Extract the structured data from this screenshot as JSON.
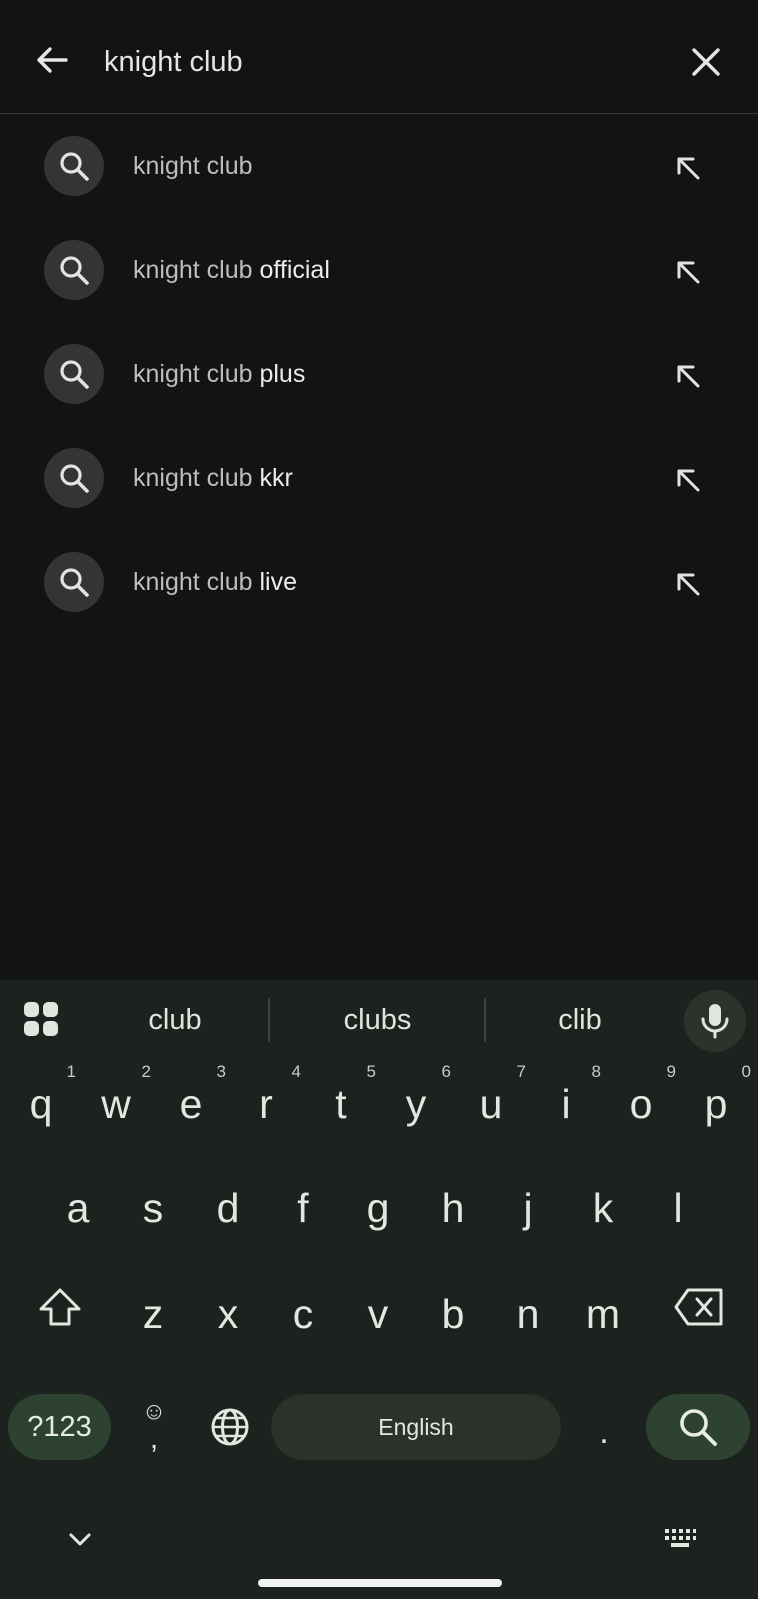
{
  "search": {
    "query": "knight club"
  },
  "suggestions": [
    {
      "prefix": "knight club",
      "suffix": ""
    },
    {
      "prefix": "knight club",
      "suffix": " official"
    },
    {
      "prefix": "knight club",
      "suffix": " plus"
    },
    {
      "prefix": "knight club",
      "suffix": " kkr"
    },
    {
      "prefix": "knight club",
      "suffix": " live"
    }
  ],
  "keyboard": {
    "predictions": [
      "club",
      "clubs",
      "clib"
    ],
    "row1": [
      {
        "key": "q",
        "hint": "1"
      },
      {
        "key": "w",
        "hint": "2"
      },
      {
        "key": "e",
        "hint": "3"
      },
      {
        "key": "r",
        "hint": "4"
      },
      {
        "key": "t",
        "hint": "5"
      },
      {
        "key": "y",
        "hint": "6"
      },
      {
        "key": "u",
        "hint": "7"
      },
      {
        "key": "i",
        "hint": "8"
      },
      {
        "key": "o",
        "hint": "9"
      },
      {
        "key": "p",
        "hint": "0"
      }
    ],
    "row2": [
      "a",
      "s",
      "d",
      "f",
      "g",
      "h",
      "j",
      "k",
      "l"
    ],
    "row3": [
      "z",
      "x",
      "c",
      "v",
      "b",
      "n",
      "m"
    ],
    "symbols_label": "?123",
    "emoji_top": "☺",
    "emoji_bottom": ",",
    "space_label": "English",
    "period": "."
  },
  "colors": {
    "background": "#131313",
    "keyboard_bg": "#1c221d",
    "accent_key": "#2e4232"
  }
}
